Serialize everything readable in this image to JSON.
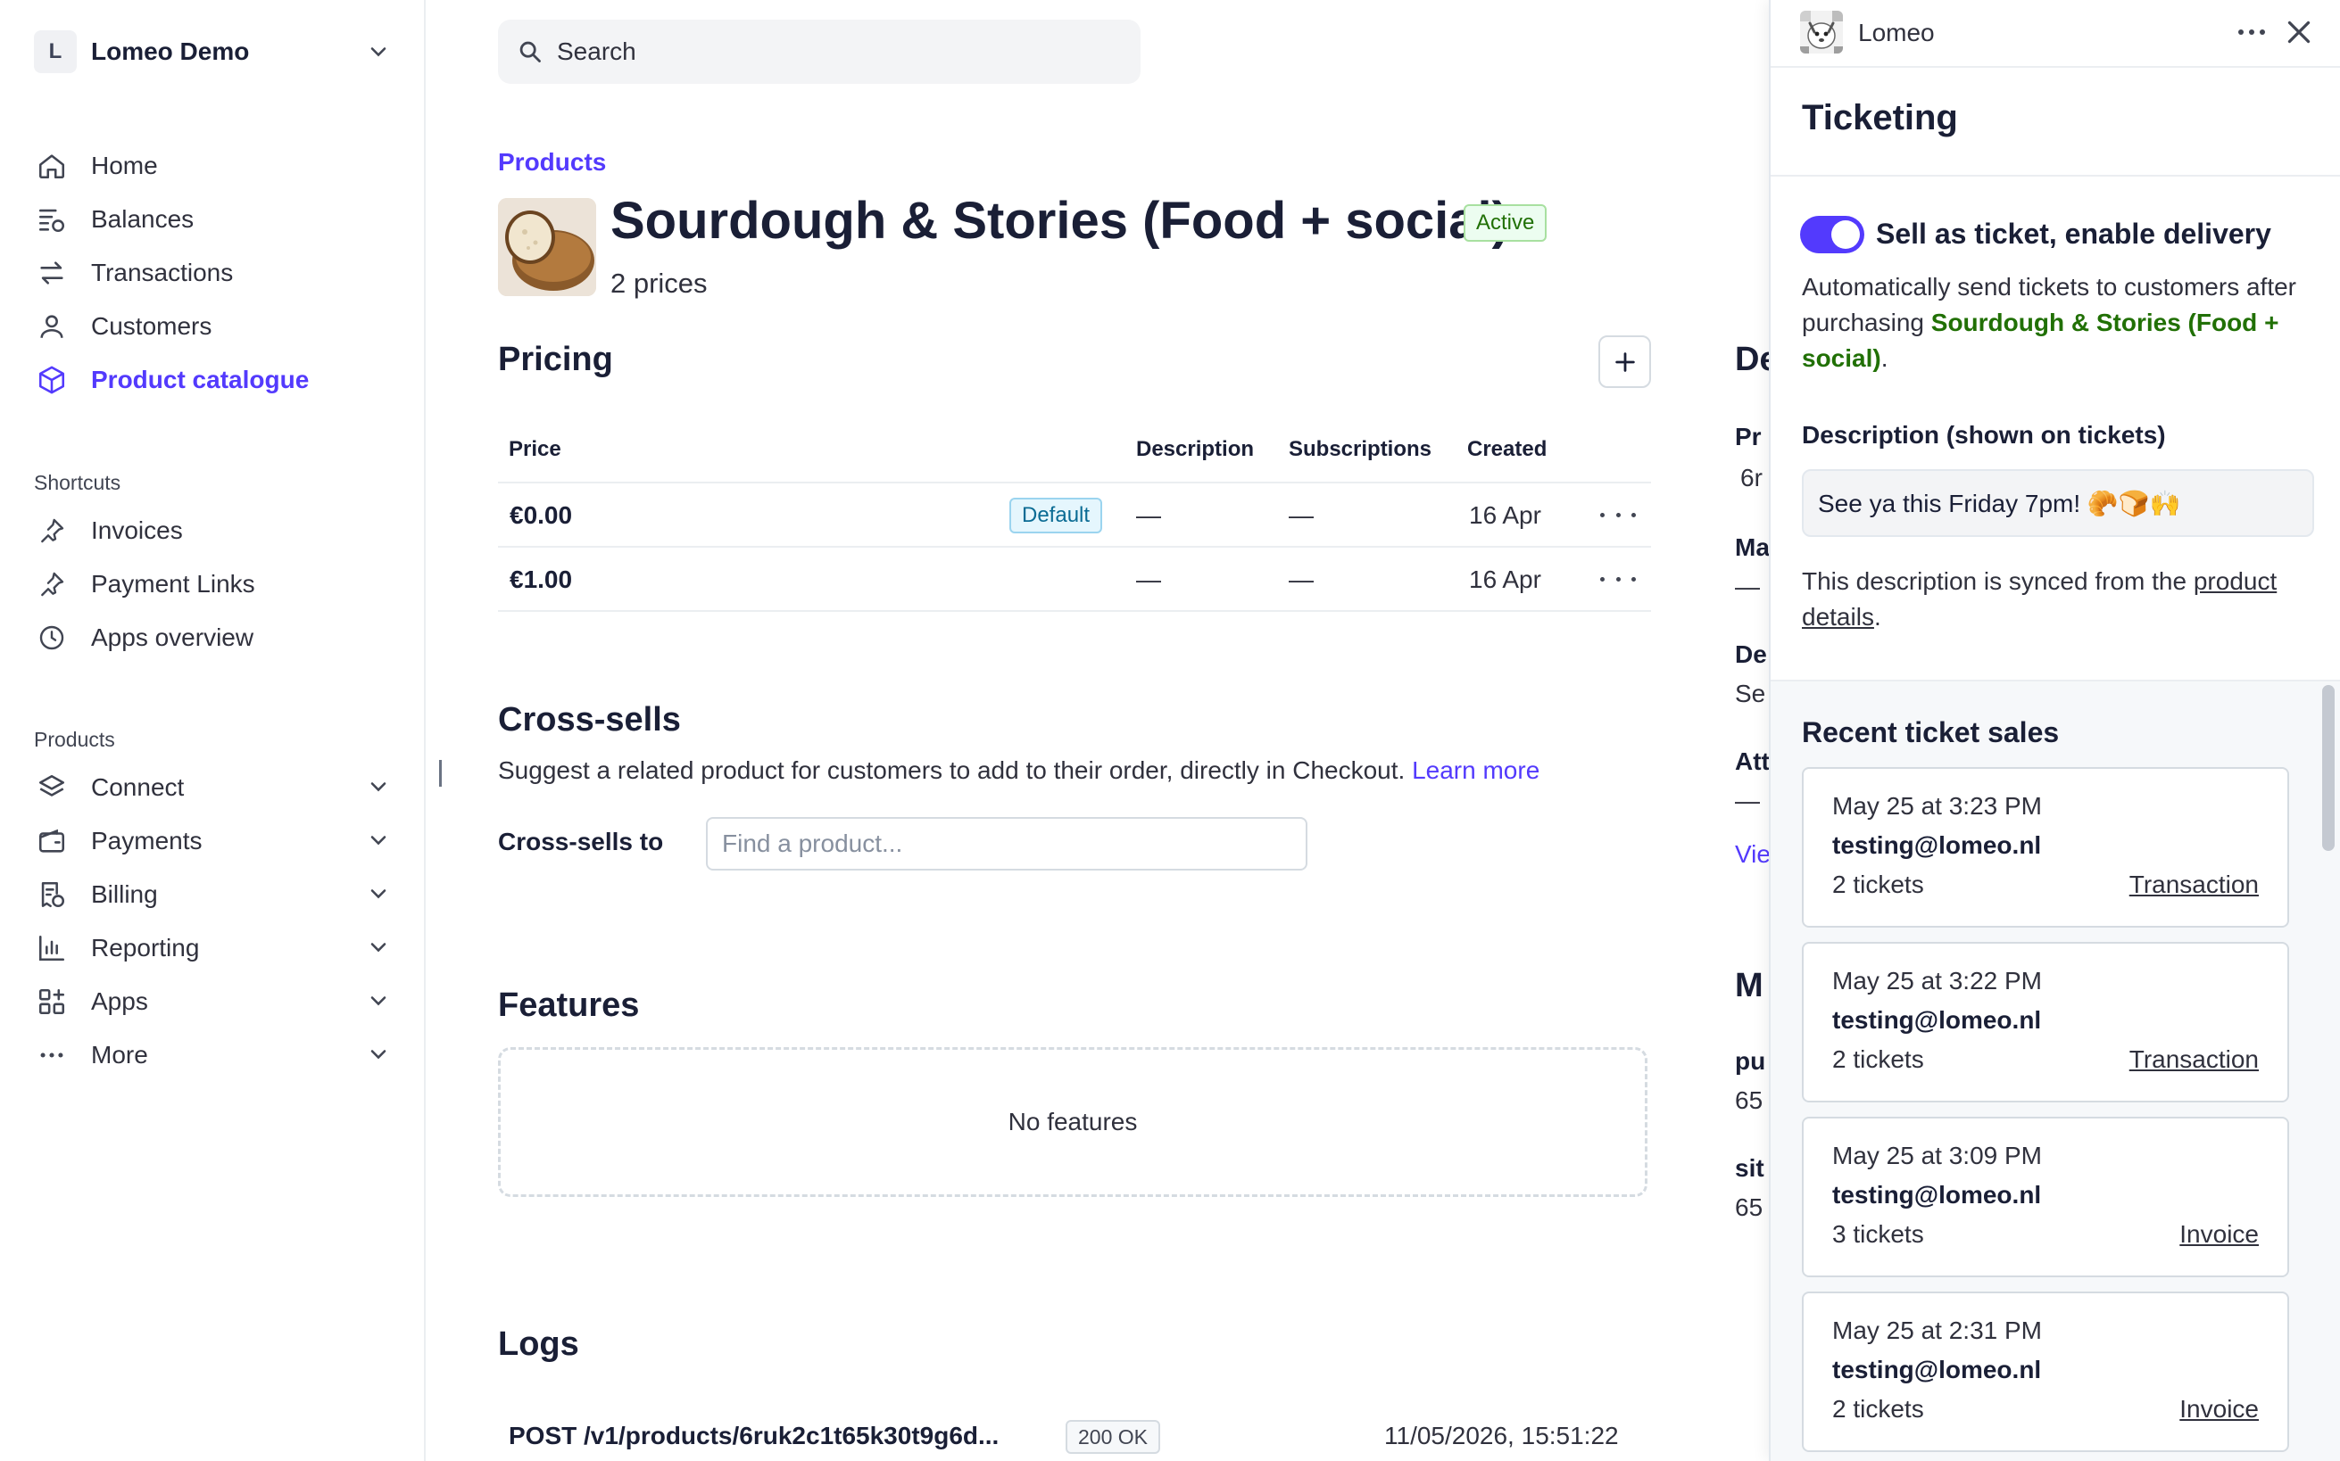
{
  "account": {
    "initial": "L",
    "name": "Lomeo Demo"
  },
  "nav": {
    "main": [
      {
        "label": "Home",
        "icon": "home-icon"
      },
      {
        "label": "Balances",
        "icon": "balances-icon"
      },
      {
        "label": "Transactions",
        "icon": "transactions-icon"
      },
      {
        "label": "Customers",
        "icon": "customers-icon"
      },
      {
        "label": "Product catalogue",
        "icon": "box-icon",
        "active": true
      }
    ],
    "shortcuts_label": "Shortcuts",
    "shortcuts": [
      {
        "label": "Invoices",
        "icon": "pin-icon"
      },
      {
        "label": "Payment Links",
        "icon": "pin-icon"
      },
      {
        "label": "Apps overview",
        "icon": "clock-icon"
      }
    ],
    "products_label": "Products",
    "products": [
      {
        "label": "Connect",
        "icon": "layers-icon"
      },
      {
        "label": "Payments",
        "icon": "wallet-icon"
      },
      {
        "label": "Billing",
        "icon": "billing-icon"
      },
      {
        "label": "Reporting",
        "icon": "chart-icon"
      },
      {
        "label": "Apps",
        "icon": "apps-icon"
      },
      {
        "label": "More",
        "icon": "more-icon"
      }
    ]
  },
  "search": {
    "placeholder": "Search"
  },
  "breadcrumb": "Products",
  "product": {
    "name": "Sourdough & Stories (Food + social)",
    "status": "Active",
    "price_count": "2 prices"
  },
  "pricing": {
    "title": "Pricing",
    "columns": [
      "Price",
      "Description",
      "Subscriptions",
      "Created"
    ],
    "rows": [
      {
        "price": "€0.00",
        "badge": "Default",
        "description": "—",
        "subscriptions": "—",
        "created": "16 Apr"
      },
      {
        "price": "€1.00",
        "badge": "",
        "description": "—",
        "subscriptions": "—",
        "created": "16 Apr"
      }
    ]
  },
  "cross_sells": {
    "title": "Cross-sells",
    "description": "Suggest a related product for customers to add to their order, directly in Checkout.",
    "learn_more": "Learn more",
    "label": "Cross-sells to",
    "placeholder": "Find a product..."
  },
  "features": {
    "title": "Features",
    "empty": "No features"
  },
  "logs": {
    "title": "Logs",
    "entries": [
      {
        "request": "POST /v1/products/6ruk2c1t65k30t9g6d...",
        "status": "200 OK",
        "time": "11/05/2026, 15:51:22"
      }
    ]
  },
  "details_peek": {
    "heading": "De",
    "pr_label": "Pr",
    "pr_value": "6r",
    "ma_label": "Ma",
    "ma_value": "—",
    "de_label": "De",
    "de_value": "Se",
    "att_label": "Att",
    "att_value": "—",
    "view_link": "Vie",
    "meta_heading": "M",
    "pu_label": "pu",
    "pu_value": "65",
    "sit_label": "sit",
    "sit_value": "65"
  },
  "drawer": {
    "app_name": "Lomeo",
    "title": "Ticketing",
    "toggle_label": "Sell as ticket, enable delivery",
    "toggle_on": true,
    "auto_text_1": "Automatically send tickets to customers after purchasing",
    "auto_product": "Sourdough & Stories (Food + social)",
    "auto_text_2": ".",
    "desc_label": "Description (shown on tickets)",
    "desc_value": "See ya this Friday 7pm! 🥐🍞🙌",
    "sync_text": "This description is synced from the",
    "sync_link": "product details",
    "sync_end": ".",
    "recent_title": "Recent ticket sales",
    "sales": [
      {
        "time": "May 25 at 3:23 PM",
        "email": "testing@lomeo.nl",
        "count": "2 tickets",
        "link": "Transaction"
      },
      {
        "time": "May 25 at 3:22 PM",
        "email": "testing@lomeo.nl",
        "count": "2 tickets",
        "link": "Transaction"
      },
      {
        "time": "May 25 at 3:09 PM",
        "email": "testing@lomeo.nl",
        "count": "3 tickets",
        "link": "Invoice"
      },
      {
        "time": "May 25 at 2:31 PM",
        "email": "testing@lomeo.nl",
        "count": "2 tickets",
        "link": "Invoice"
      }
    ]
  },
  "colors": {
    "accent": "#533afd",
    "green": "#217005",
    "text": "#1a1f36"
  }
}
